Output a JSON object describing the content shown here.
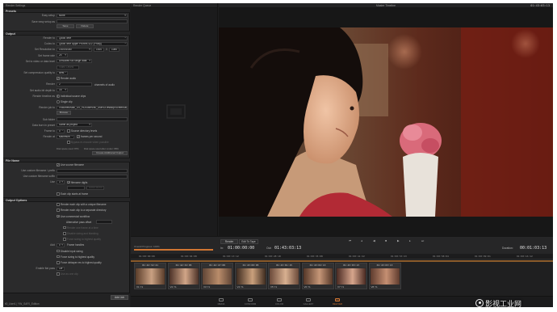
{
  "settings_panel": {
    "title": "Render Settings",
    "presets_header": "Presets",
    "easy_setup_label": "Easy setup",
    "easy_setup_value": "None",
    "save_setup_label": "Save easy setup as",
    "save_btn": "Save",
    "delete_btn": "Delete",
    "output_header": "Output",
    "render_to_label": "Render to",
    "render_to_value": "QuickTime",
    "codec_label": "Codec to",
    "codec_value": "QuickTime Apple ProRes 422 (Proxy)",
    "resolution_label": "Set Resolution to",
    "resolution_value": "1920x1080",
    "res_w": "1920",
    "res_x": "X",
    "res_h": "1080",
    "frame_rate_label": "Set frame rate",
    "frame_rate_value": "24",
    "data_levels_label": "Set to video or data level",
    "data_levels_value": "Unscaled full range data",
    "data_levels_value2": "Video Levels",
    "compression_label": "Set compression quality to",
    "compression_value": "Best",
    "render_audio_label": "Render audio",
    "channels_label": "Render",
    "channels_value": "2",
    "channels_suffix": "channels of audio",
    "bit_depth_label": "Set audio bit depth to",
    "bit_depth_value": "16",
    "timeline_as_label": "Render timeline as",
    "individual_clips": "Individual source clips",
    "single_clip": "Single clip",
    "render_job_label": "Render job to",
    "render_job_value": "/Volumes/Mac_OS_HD/Users/tl0_User1/Desktop/Screencast",
    "browse_btn": "Browse",
    "sub_folder_label": "Sub folder",
    "data_burn_label": "Data burn in preset",
    "data_burn_value": "Same as project",
    "frame_label": "Frame to",
    "frame_value": "0",
    "frame_suffix": "Source directory levels",
    "render_at_label": "Render at",
    "render_at_value": "Maximum",
    "render_at_value2": "frames per second",
    "bypass_label": "Bypass re-encode when possible",
    "disk_space_a": "Disk space used: 87%",
    "disk_space_b": "Disk space used after render: 88%",
    "create_btn": "Create Additional Output",
    "file_name_header": "File Name",
    "use_unique_label": "Use source filename",
    "custom_name_label": "Use custom filename / prefix",
    "custom_suffix_label": "Use custom filename suffix",
    "unique_label": "Use",
    "unique_value": "3",
    "unique_suffix": "filename digits",
    "each_clip_label": "Each clip starts at frame",
    "each_clip_value": "00:00:00:00",
    "output_options_header": "Output Options",
    "opt1": "Render each clip with a unique filename",
    "opt2": "Render each clip to a separate directory",
    "opt3": "Use commercial workflow",
    "opt4": "Alternative pass offset",
    "opt5": "Render one frame at a time",
    "opt6": "Disable sizing and blanking",
    "opt7": "Force sizing to highest quality",
    "add_label": "Add",
    "add_value": "0",
    "add_suffix": "Frame handles",
    "opt8": "Disable input sizing",
    "opt9": "Force sizing to highest quality",
    "opt10": "Force debayer res to highest quality",
    "enable_flat_label": "Enable flat pass",
    "enable_flat_value": "Off",
    "opt11": "Use as one clip",
    "add_job_btn": "Add Job",
    "status_text": "tl0_User1 | YW_SAF0_Edition"
  },
  "queue": {
    "title": "Render Queue",
    "start_render_btn": "Start Render",
    "progress_label": "Overall Progress: 100%"
  },
  "viewer": {
    "title": "Master Timeline",
    "timecode": "01:43:03:13",
    "tab_render": "Render",
    "tab_edit": "Edit To Tape",
    "in_label": "In:",
    "in_value": "01:00:00:00",
    "out_label": "Out:",
    "out_value": "01:43:03:13",
    "duration_label": "Duration:",
    "duration_value": "00:01:03:13"
  },
  "timeline": {
    "ruler_ticks": [
      "01:00:00:00",
      "01:00:04:08",
      "01:00:13:12",
      "01:00:28:18",
      "01:00:35:08",
      "01:00:41:22",
      "01:00:53:23",
      "01:00:58:04",
      "01:00:09:01",
      "01:00:16:12"
    ],
    "clips": [
      {
        "tc": "01:42:32:21",
        "name": "V1 Y1"
      },
      {
        "tc": "01:42:32:05",
        "name": "V2 Y1"
      },
      {
        "tc": "01:42:47:08",
        "name": "V3 Y1"
      },
      {
        "tc": "01:43:00:05",
        "name": "V4 Y1"
      },
      {
        "tc": "01:43:01:15",
        "name": "V5 Y1"
      },
      {
        "tc": "01:43:02:13",
        "name": "V6 Y1"
      },
      {
        "tc": "01:43:03:13",
        "name": "V7 Y1"
      },
      {
        "tc": "01:43:03:13",
        "name": "V8 Y1"
      }
    ]
  },
  "pages": [
    {
      "label": "MEDIA",
      "active": false
    },
    {
      "label": "CONFORM",
      "active": false
    },
    {
      "label": "COLOR",
      "active": false
    },
    {
      "label": "GALLERY",
      "active": false
    },
    {
      "label": "DELIVER",
      "active": true
    }
  ],
  "watermark": "影视工业网",
  "colors": {
    "accent": "#d07532",
    "panel": "#2b2b2c",
    "background": "#1e1e1f"
  }
}
